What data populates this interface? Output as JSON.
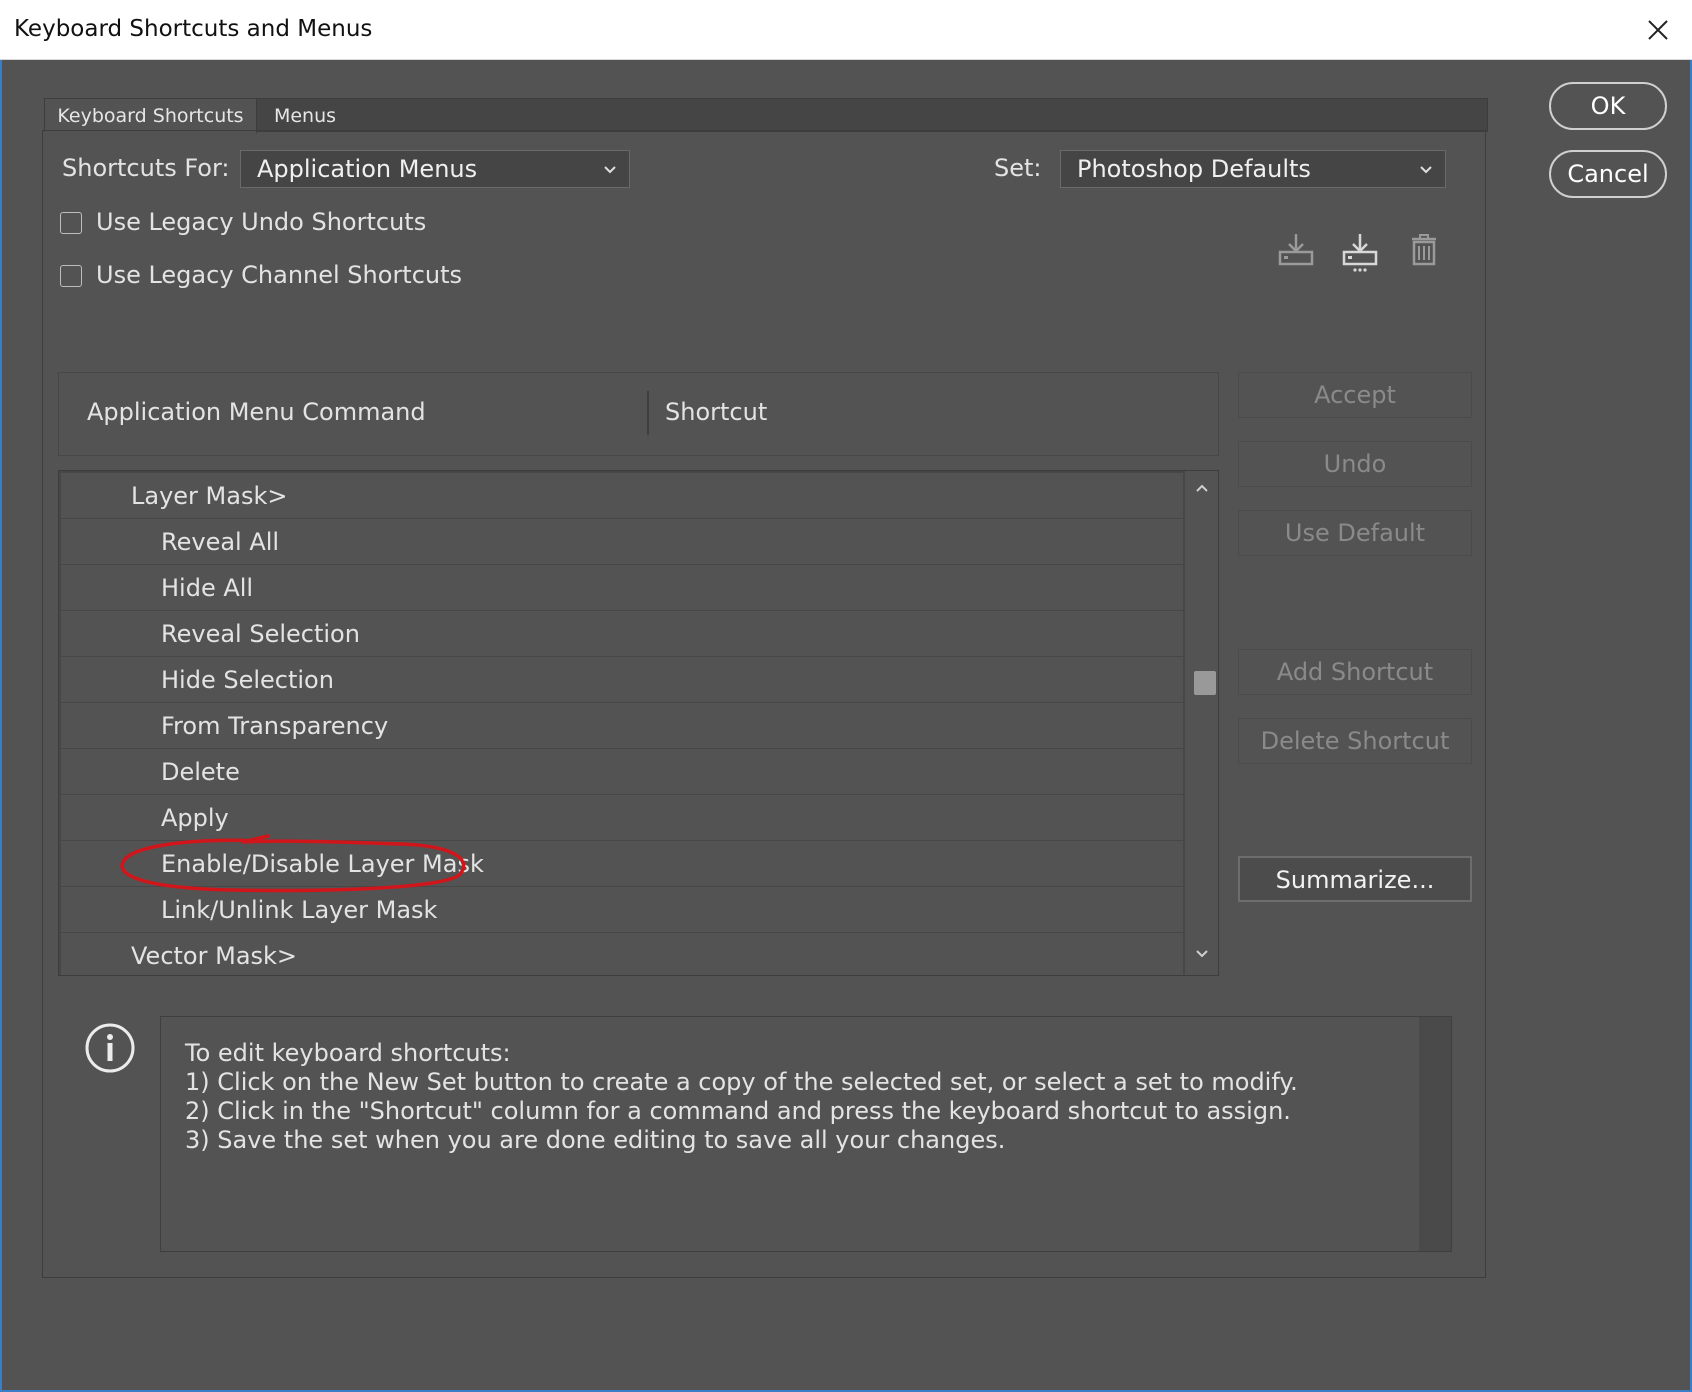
{
  "window": {
    "title": "Keyboard Shortcuts and Menus"
  },
  "tabs": [
    {
      "label": "Keyboard Shortcuts"
    },
    {
      "label": "Menus"
    }
  ],
  "shortcuts_for": {
    "label": "Shortcuts For:",
    "value": "Application Menus"
  },
  "set": {
    "label": "Set:",
    "value": "Photoshop Defaults"
  },
  "checkboxes": [
    {
      "label": "Use Legacy Undo Shortcuts",
      "checked": false
    },
    {
      "label": "Use Legacy Channel Shortcuts",
      "checked": false
    }
  ],
  "table": {
    "columns": [
      "Application Menu Command",
      "Shortcut"
    ],
    "rows": [
      {
        "label": "Layer Mask>",
        "level": 1
      },
      {
        "label": "Reveal All",
        "level": 2
      },
      {
        "label": "Hide All",
        "level": 2
      },
      {
        "label": "Reveal Selection",
        "level": 2
      },
      {
        "label": "Hide Selection",
        "level": 2
      },
      {
        "label": "From Transparency",
        "level": 2
      },
      {
        "label": "Delete",
        "level": 2
      },
      {
        "label": "Apply",
        "level": 2
      },
      {
        "label": "Enable/Disable Layer Mask",
        "level": 2,
        "annotated": true
      },
      {
        "label": "Link/Unlink Layer Mask",
        "level": 2
      },
      {
        "label": "Vector Mask>",
        "level": 1
      }
    ]
  },
  "side_buttons": {
    "accept": "Accept",
    "undo": "Undo",
    "use_default": "Use Default",
    "add_shortcut": "Add Shortcut",
    "delete_shortcut": "Delete Shortcut",
    "summarize": "Summarize..."
  },
  "dialog_buttons": {
    "ok": "OK",
    "cancel": "Cancel"
  },
  "info": {
    "icon": "info-icon",
    "lines": [
      "To edit keyboard shortcuts:",
      "1) Click on the New Set button to create a copy of the selected set, or select a set to modify.",
      "2) Click in the \"Shortcut\" column for a command and press the keyboard shortcut to assign.",
      "3) Save the set when you are done editing to save all your changes."
    ]
  },
  "colors": {
    "dialog_bg": "#535353",
    "annotation": "#d0161b",
    "accent_border": "#3a7ec8"
  }
}
